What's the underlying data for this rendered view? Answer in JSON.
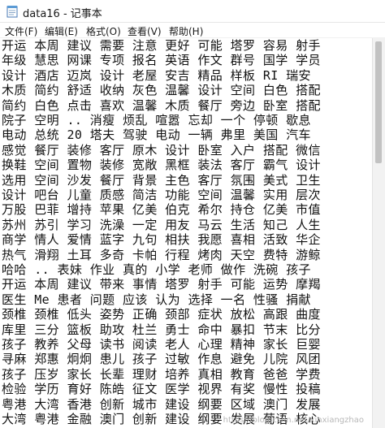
{
  "window": {
    "title": "data16 - 记事本",
    "icon": "notepad-icon"
  },
  "menu": [
    {
      "label": "文件(F)"
    },
    {
      "label": "编辑(E)"
    },
    {
      "label": "格式(O)"
    },
    {
      "label": "查看(V)"
    },
    {
      "label": "帮助(H)"
    }
  ],
  "content": {
    "lines": [
      "开运 本周 建议 需要 注意 更好 可能 塔罗 容易 射手",
      "年级 慧思 网课 专项 报名 英语 作文 群号 国学 学员",
      "设计 酒店 迈岚 设计 老屋 安吉 精品 样板 RI 瑞安",
      "木质 简约 舒适 收纳 灰色 温馨 设计 空间 白色 搭配",
      "简约 白色 点击 喜欢 温馨 木质 餐厅 旁边 卧室 搭配",
      "院子 空明 .. 消瘦 烦乱 喧嚣 忘却 一个 停顿 歇息",
      "电动 总统 20 塔夫 驾驶 电动 一辆 弗里 美国 汽车",
      "感觉 餐厅 装修 客厅 原木 设计 卧室 入户 搭配 微信",
      "换鞋 空间 置物 装修 宽敞 黑框 装法 客厅 霸气 设计",
      "选用 空间 沙发 餐厅 背景 主色 客厅 氛围 美式 卫生",
      "设计 吧台 儿童 质感 简洁 功能 空间 温馨 实用 层次",
      "万股 巴菲 增持 苹果 亿美 伯克 希尔 持仓 亿美 市值",
      "苏州 苏引 学习 洗澡 一定 用友 马云 生活 知己 人生",
      "商学 情人 爱情 蓝字 九句 相扶 我愿 喜相 活致 华企",
      "热气 滑翔 土耳 多奇 卡帕 行程 烤肉 天空 费特 游鲸",
      "哈哈 .. 表妹 作业 真的 小学 老师 做作 洗碗 孩子",
      "开运 本周 建议 带来 事情 塔罗 射手 可能 运势 摩羯",
      "医生 Me 患者 问题 应该 认为 选择 一名 性骚 捐献",
      "颈椎 颈椎 低头 姿势 正确 颈部 症状 放松 高跟 曲度",
      "库里 三分 篮板 助攻 杜兰 勇士 命中 暴扣 节末 比分",
      "孩子 教养 父母 读书 阅读 老人 心理 精神 家长 巨婴",
      "寻麻 郑惠 炯炯 患儿 孩子 过敏 作息 避免 儿院 风团",
      "孩子 压岁 家长 长辈 理财 培养 真相 教育 爸爸 学费",
      "检验 学历 育好 陈皓 征文 医学 视界 有奖 慢性 投稿",
      "粤港 大湾 香港 创新 城市 建设 纲要 区域 澳门 发展",
      "大湾 粤港 金融 澳门 创新 建设 纲要 发展 葡语 核心"
    ]
  },
  "watermark": "https://blog.csdn.net/xinxiangzhao"
}
